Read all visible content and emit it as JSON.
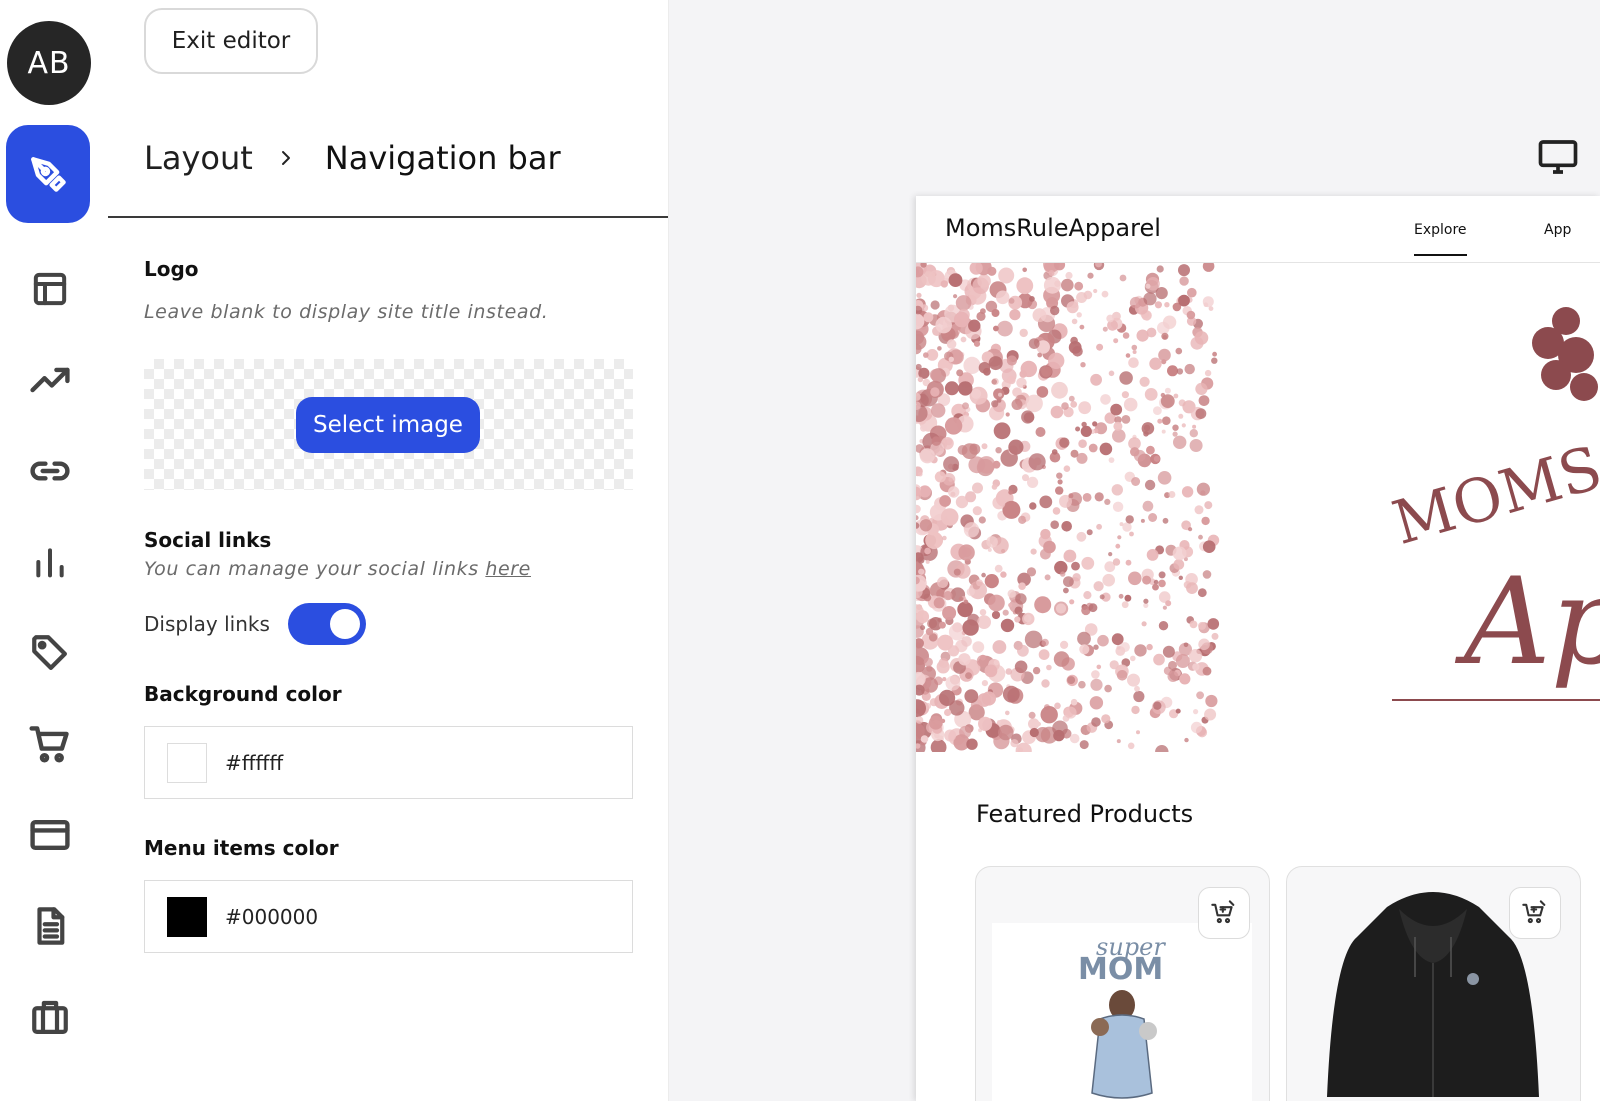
{
  "user": {
    "initials": "AB"
  },
  "rail": {
    "items": [
      {
        "name": "design"
      },
      {
        "name": "layout"
      },
      {
        "name": "analytics"
      },
      {
        "name": "links"
      },
      {
        "name": "stats"
      },
      {
        "name": "tags"
      },
      {
        "name": "cart"
      },
      {
        "name": "payments"
      },
      {
        "name": "pages"
      },
      {
        "name": "business"
      }
    ]
  },
  "panel": {
    "exit_label": "Exit editor",
    "breadcrumb": {
      "parent": "Layout",
      "current": "Navigation bar"
    },
    "logo": {
      "label": "Logo",
      "hint": "Leave blank to display site title instead.",
      "select_label": "Select image"
    },
    "social": {
      "label": "Social links",
      "hint": "You can manage your social links",
      "hint_link": "here",
      "display_label": "Display links",
      "display_on": true
    },
    "background_color": {
      "label": "Background color",
      "value": "#ffffff"
    },
    "menu_color": {
      "label": "Menu items color",
      "value": "#000000"
    }
  },
  "preview": {
    "site_title": "MomsRuleApparel",
    "nav": [
      {
        "label": "Explore",
        "active": true
      },
      {
        "label": "App",
        "active": false
      }
    ],
    "hero_text": [
      "MOMS",
      "Ap"
    ],
    "featured_heading": "Featured Products",
    "products": [
      {
        "art_text_1": "super",
        "art_text_2": "MOM"
      },
      {
        "art_text_1": "",
        "art_text_2": ""
      }
    ]
  },
  "colors": {
    "accent": "#2b4ee0",
    "brand": "#8c4a4e",
    "glitter": "#d89a9c"
  }
}
